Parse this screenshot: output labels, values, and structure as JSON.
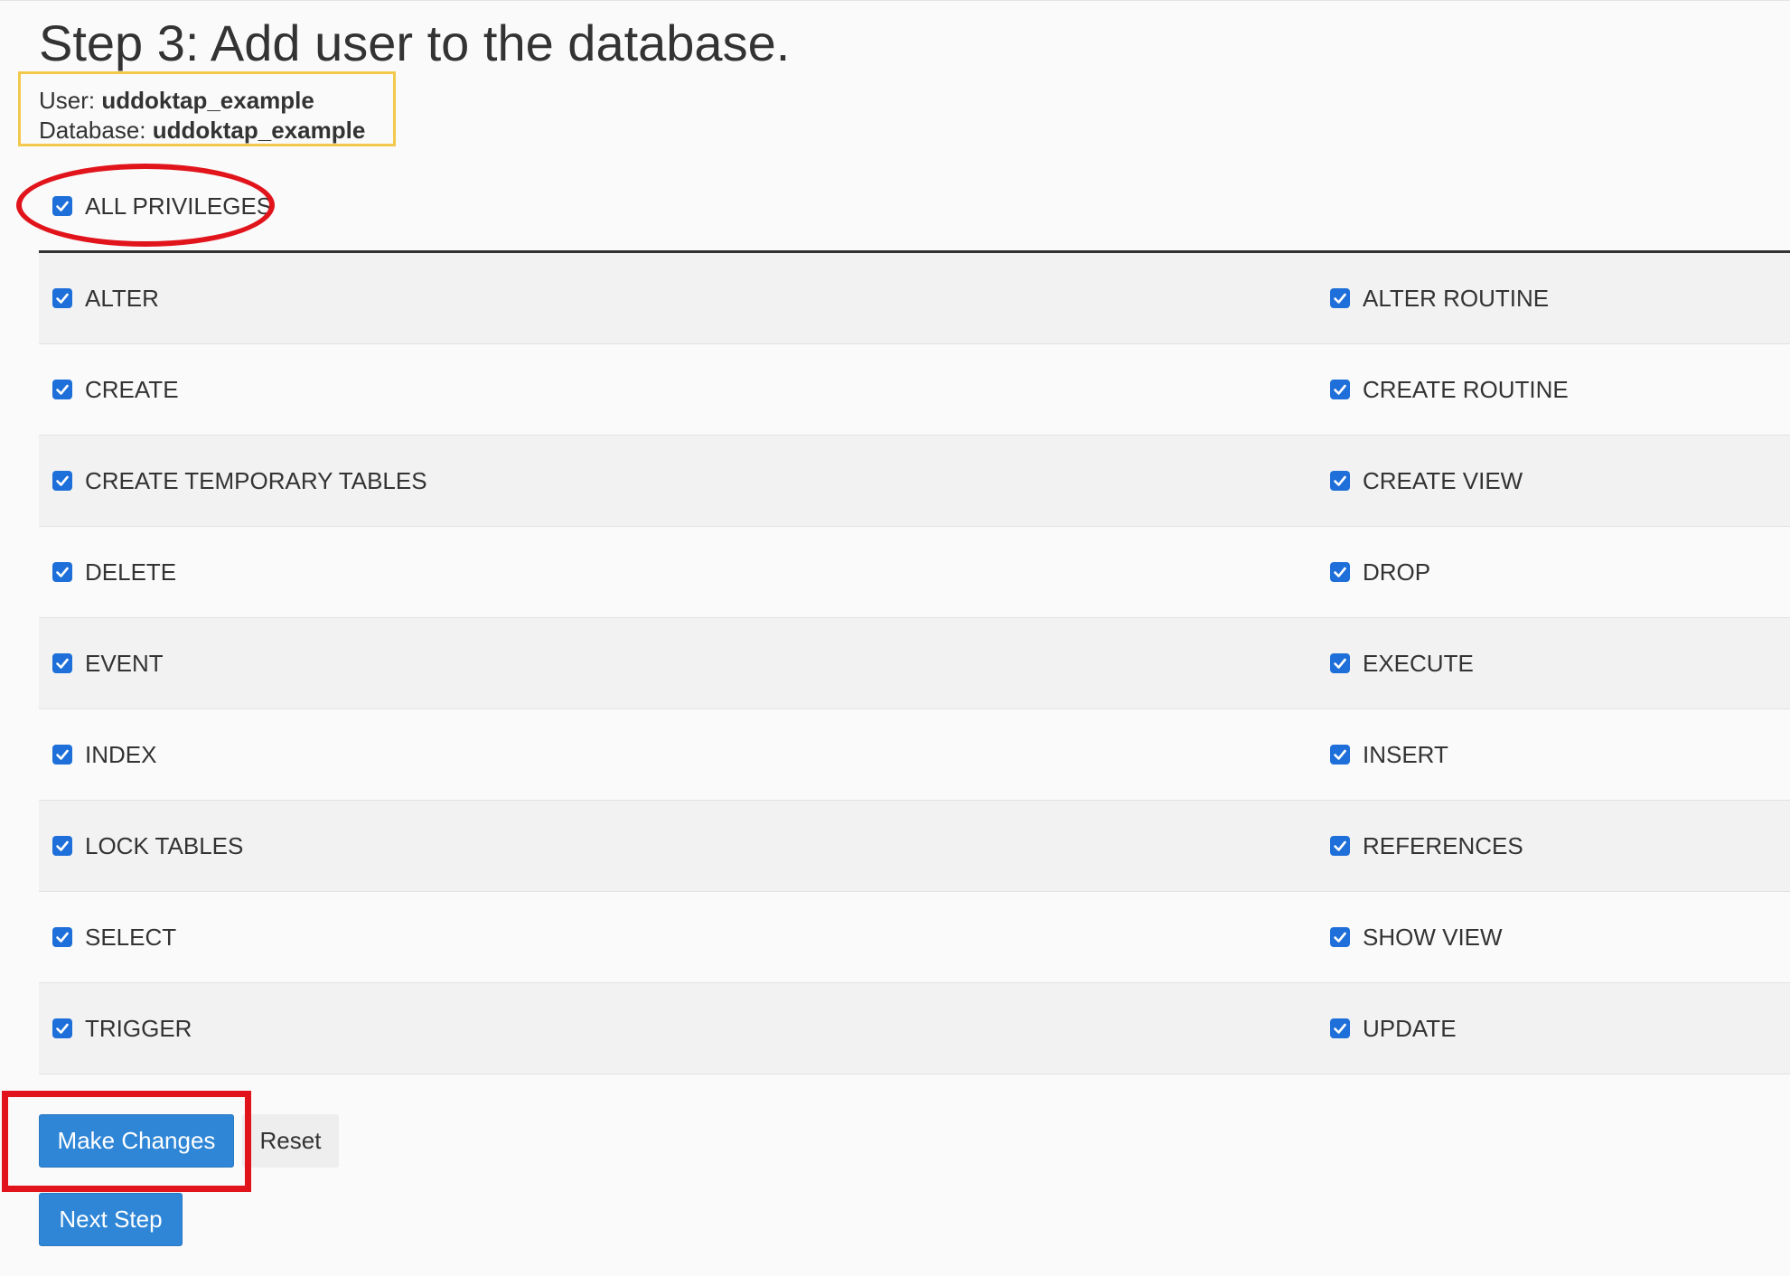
{
  "page": {
    "title": "Step 3: Add user to the database."
  },
  "info": {
    "user_label": "User:",
    "user_value": "uddoktap_example",
    "database_label": "Database:",
    "database_value": "uddoktap_example"
  },
  "all_privileges": {
    "label": "ALL PRIVILEGES",
    "checked": true
  },
  "privileges": [
    {
      "left": "ALTER",
      "right": "ALTER ROUTINE"
    },
    {
      "left": "CREATE",
      "right": "CREATE ROUTINE"
    },
    {
      "left": "CREATE TEMPORARY TABLES",
      "right": "CREATE VIEW"
    },
    {
      "left": "DELETE",
      "right": "DROP"
    },
    {
      "left": "EVENT",
      "right": "EXECUTE"
    },
    {
      "left": "INDEX",
      "right": "INSERT"
    },
    {
      "left": "LOCK TABLES",
      "right": "REFERENCES"
    },
    {
      "left": "SELECT",
      "right": "SHOW VIEW"
    },
    {
      "left": "TRIGGER",
      "right": "UPDATE"
    }
  ],
  "buttons": {
    "make_changes": "Make Changes",
    "reset": "Reset",
    "next_step": "Next Step"
  },
  "colors": {
    "checkbox": "#1e6fd9",
    "primary_button": "#2f86d6",
    "highlight_red": "#e1141c",
    "highlight_yellow": "#f2c94c"
  }
}
